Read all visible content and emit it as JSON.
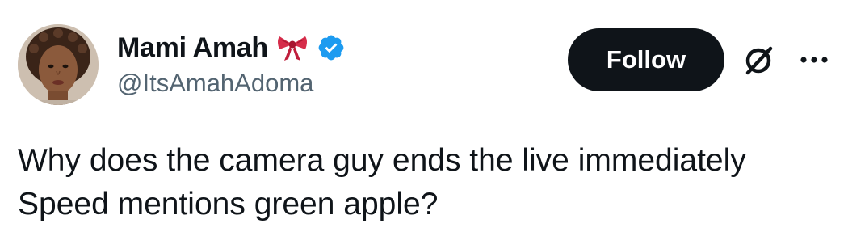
{
  "author": {
    "display_name": "Mami Amah",
    "handle": "@ItsAmahAdoma",
    "avatar_icon": "profile-photo",
    "badge_emoji": "ribbon-bow-icon",
    "verified_icon": "verified-badge-icon",
    "verified_color": "#1d9bf0"
  },
  "actions": {
    "follow_label": "Follow",
    "grok_icon": "grok-icon",
    "more_icon": "more-options-icon"
  },
  "tweet": {
    "line1": "Why does the camera guy ends the live immediately",
    "line2": "Speed mentions green apple?"
  },
  "colors": {
    "text": "#0f1419",
    "secondary": "#536471",
    "button_bg": "#0f1419",
    "button_text": "#ffffff",
    "verified": "#1d9bf0"
  }
}
